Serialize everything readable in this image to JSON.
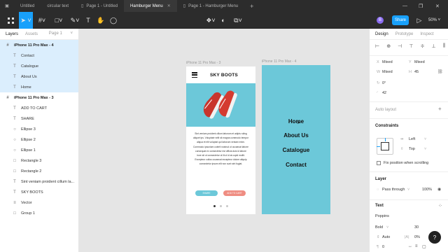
{
  "tabs": [
    {
      "label": "Untitled"
    },
    {
      "label": "circular text"
    },
    {
      "label": "Page 1 - Untitled"
    },
    {
      "label": "Hamburger Menu"
    },
    {
      "label": "Page 1 - Hamburger Menu"
    }
  ],
  "toolbar": {
    "share_label": "Share",
    "zoom_label": "50%",
    "avatar_initial": "B"
  },
  "left_panel": {
    "tab_layers": "Layers",
    "tab_assets": "Assets",
    "page_label": "Page 1",
    "layers": [
      {
        "label": "iPhone 11 Pro Max - 4",
        "icon": "#"
      },
      {
        "label": "Contact",
        "icon": "T"
      },
      {
        "label": "Catalogue",
        "icon": "T"
      },
      {
        "label": "About Us",
        "icon": "T"
      },
      {
        "label": "Home",
        "icon": "T"
      },
      {
        "label": "iPhone 11 Pro Max - 3",
        "icon": "#"
      },
      {
        "label": "ADD TO CART",
        "icon": "T"
      },
      {
        "label": "SHARE",
        "icon": "T"
      },
      {
        "label": "Ellipse 3",
        "icon": "○"
      },
      {
        "label": "Ellipse 2",
        "icon": "○"
      },
      {
        "label": "Ellipse 1",
        "icon": "○"
      },
      {
        "label": "Rectangle 3",
        "icon": "□"
      },
      {
        "label": "Rectangle 2",
        "icon": "□"
      },
      {
        "label": "Sint veniam proident cillum la...",
        "icon": "T"
      },
      {
        "label": "SKY BOOTS",
        "icon": "T"
      },
      {
        "label": "Vector",
        "icon": "≡"
      },
      {
        "label": "Group 1",
        "icon": "□"
      }
    ]
  },
  "canvas": {
    "frame3_label": "iPhone 11 Pro Max - 3",
    "frame4_label": "iPhone 11 Pro Max - 4",
    "brand": "SKY BOOTS",
    "body_text": "Sint veniam proident cillum laborum et adipis ruling aliquet ips. Voluptate velit sit magna commodo tempor aliqua et elit voluptat qui laborum veniam enim. Commodo ipsuniam cuterit nostrud ut occaecat labore consequat ex consectetur est officia duis id labore irure sit ut consectetur ut lit ut id at cupid mollit. Excepteur cullus occaecat excepteur dolore aliquip consectetur ipsum elit non sunt sint fugiat.",
    "share_btn": "SHARE",
    "cart_btn": "ADD TO CART",
    "menu": [
      "Home",
      "About Us",
      "Catalogue",
      "Contact"
    ]
  },
  "right_panel": {
    "tab_design": "Design",
    "tab_prototype": "Prototype",
    "tab_inspect": "Inspect",
    "x_value": "Mixed",
    "y_value": "Mixed",
    "w_value": "Mixed",
    "h_value": "45",
    "rotation": "0°",
    "radius": "42",
    "auto_layout": "Auto layout",
    "constraints": "Constraints",
    "left": "Left",
    "top": "Top",
    "fix_position": "Fix position when scrolling",
    "layer": "Layer",
    "pass_through": "Pass through",
    "opacity": "100%",
    "text_section": "Text",
    "font": "Poppins",
    "weight": "Bold",
    "size": "30",
    "line_height": "Auto",
    "letter_spacing": "0%",
    "para_spacing": "0"
  }
}
